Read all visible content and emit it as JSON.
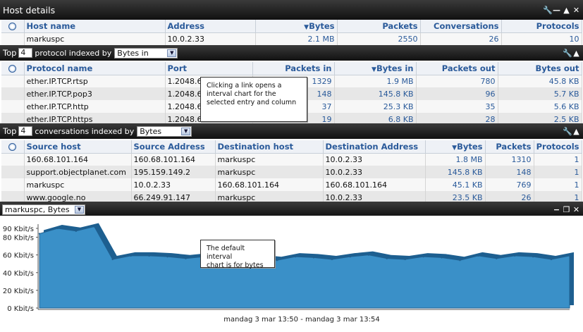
{
  "host_panel": {
    "title": "Host details",
    "columns": [
      "Host name",
      "Address",
      "Bytes",
      "Packets",
      "Conversations",
      "Protocols"
    ],
    "rows": [
      {
        "host": "markuspc",
        "address": "10.0.2.33",
        "bytes": "2.1 MB",
        "packets": "2550",
        "conversations": "26",
        "protocols": "10"
      }
    ]
  },
  "protocol_panel": {
    "top_label": "Top",
    "top_value": "4",
    "indexed_label": "protocol indexed by",
    "indexed_by": "Bytes in",
    "columns": [
      "Protocol name",
      "Port",
      "Packets in",
      "Bytes in",
      "Packets out",
      "Bytes out"
    ],
    "rows": [
      {
        "name": "ether.IP.TCP.rtsp",
        "port": "1.2048.6",
        "packets_in": "1329",
        "bytes_in": "1.9 MB",
        "packets_out": "780",
        "bytes_out": "45.8 KB"
      },
      {
        "name": "ether.IP.TCP.pop3",
        "port": "1.2048.6",
        "packets_in": "148",
        "bytes_in": "145.8 KB",
        "packets_out": "96",
        "bytes_out": "5.7 KB"
      },
      {
        "name": "ether.IP.TCP.http",
        "port": "1.2048.6",
        "packets_in": "37",
        "bytes_in": "25.3 KB",
        "packets_out": "35",
        "bytes_out": "5.6 KB"
      },
      {
        "name": "ether.IP.TCP.https",
        "port": "1.2048.6",
        "packets_in": "19",
        "bytes_in": "6.8 KB",
        "packets_out": "28",
        "bytes_out": "2.5 KB"
      }
    ],
    "tooltip": [
      "Clicking a link opens a",
      "interval chart for the",
      "selected entry and column"
    ]
  },
  "conversation_panel": {
    "top_label": "Top",
    "top_value": "4",
    "indexed_label": "conversations indexed by",
    "indexed_by": "Bytes",
    "columns": [
      "Source host",
      "Source Address",
      "Destination host",
      "Destination Address",
      "Bytes",
      "Packets",
      "Protocols"
    ],
    "rows": [
      {
        "src_host": "160.68.101.164",
        "src_addr": "160.68.101.164",
        "dst_host": "markuspc",
        "dst_addr": "10.0.2.33",
        "bytes": "1.8 MB",
        "packets": "1310",
        "protocols": "1"
      },
      {
        "src_host": "support.objectplanet.com",
        "src_addr": "195.159.149.2",
        "dst_host": "markuspc",
        "dst_addr": "10.0.2.33",
        "bytes": "145.8 KB",
        "packets": "148",
        "protocols": "1"
      },
      {
        "src_host": "markuspc",
        "src_addr": "10.0.2.33",
        "dst_host": "160.68.101.164",
        "dst_addr": "160.68.101.164",
        "bytes": "45.1 KB",
        "packets": "769",
        "protocols": "1"
      },
      {
        "src_host": "www.google.no",
        "src_addr": "66.249.91.147",
        "dst_host": "markuspc",
        "dst_addr": "10.0.2.33",
        "bytes": "23.5 KB",
        "packets": "26",
        "protocols": "1"
      }
    ]
  },
  "chart_panel": {
    "selector": "markuspc, Bytes",
    "tooltip": [
      "The default interval",
      "chart is for bytes"
    ]
  },
  "chart_data": {
    "type": "area",
    "x_label": "mandag 3 mar 13:50 - mandag 3 mar 13:54",
    "y_ticks": [
      "0 Kbit/s",
      "20 Kbit/s",
      "40 Kbit/s",
      "60 Kbit/s",
      "80 Kbit/s",
      "90 Kbit/s"
    ],
    "y_tick_values": [
      0,
      20,
      40,
      60,
      80,
      90
    ],
    "ylim": [
      0,
      90
    ],
    "values": [
      84,
      90,
      87,
      92,
      55,
      59,
      59,
      58,
      56,
      58,
      57,
      59,
      56,
      54,
      58,
      57,
      55,
      58,
      60,
      56,
      55,
      58,
      57,
      54,
      59,
      56,
      59,
      58,
      55,
      59
    ],
    "fill_color": "#3a90c8",
    "stroke_color": "#1f5f8f"
  },
  "colors": {
    "header_text": "#2a5a9a",
    "titlebar": "#1a1a1a"
  }
}
